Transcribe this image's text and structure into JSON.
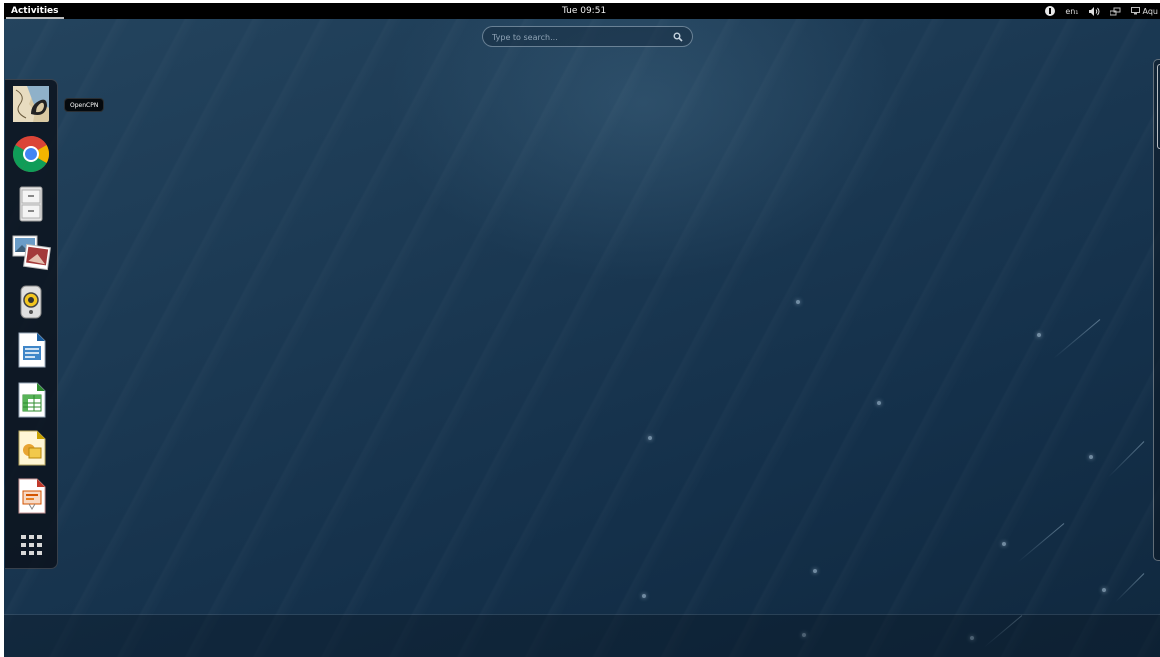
{
  "top_bar": {
    "activities_label": "Activities",
    "clock": "Tue 09:51",
    "tray": {
      "accessibility_icon": "accessibility-icon",
      "keyboard_layout": "en₁",
      "volume_icon": "volume-icon",
      "network_icon": "network-icon",
      "user_label": "Aqu"
    }
  },
  "search": {
    "placeholder": "Type to search...",
    "icon": "search-icon"
  },
  "dash": {
    "items": [
      {
        "name": "OpenCPN",
        "icon": "opencpn-icon"
      },
      {
        "name": "Google Chrome",
        "icon": "chrome-icon"
      },
      {
        "name": "Files",
        "icon": "file-cabinet-icon"
      },
      {
        "name": "Image Viewer",
        "icon": "photos-icon"
      },
      {
        "name": "Rhythmbox",
        "icon": "speaker-icon"
      },
      {
        "name": "LibreOffice Writer",
        "icon": "writer-icon"
      },
      {
        "name": "LibreOffice Calc",
        "icon": "calc-icon"
      },
      {
        "name": "LibreOffice Draw",
        "icon": "draw-icon"
      },
      {
        "name": "LibreOffice Impress",
        "icon": "impress-icon"
      }
    ],
    "show_apps_icon": "app-grid-icon",
    "tooltip": "OpenCPN"
  },
  "colors": {
    "top_bar": "#000000",
    "background": "#1c3a54",
    "dash": "#0a1018"
  }
}
